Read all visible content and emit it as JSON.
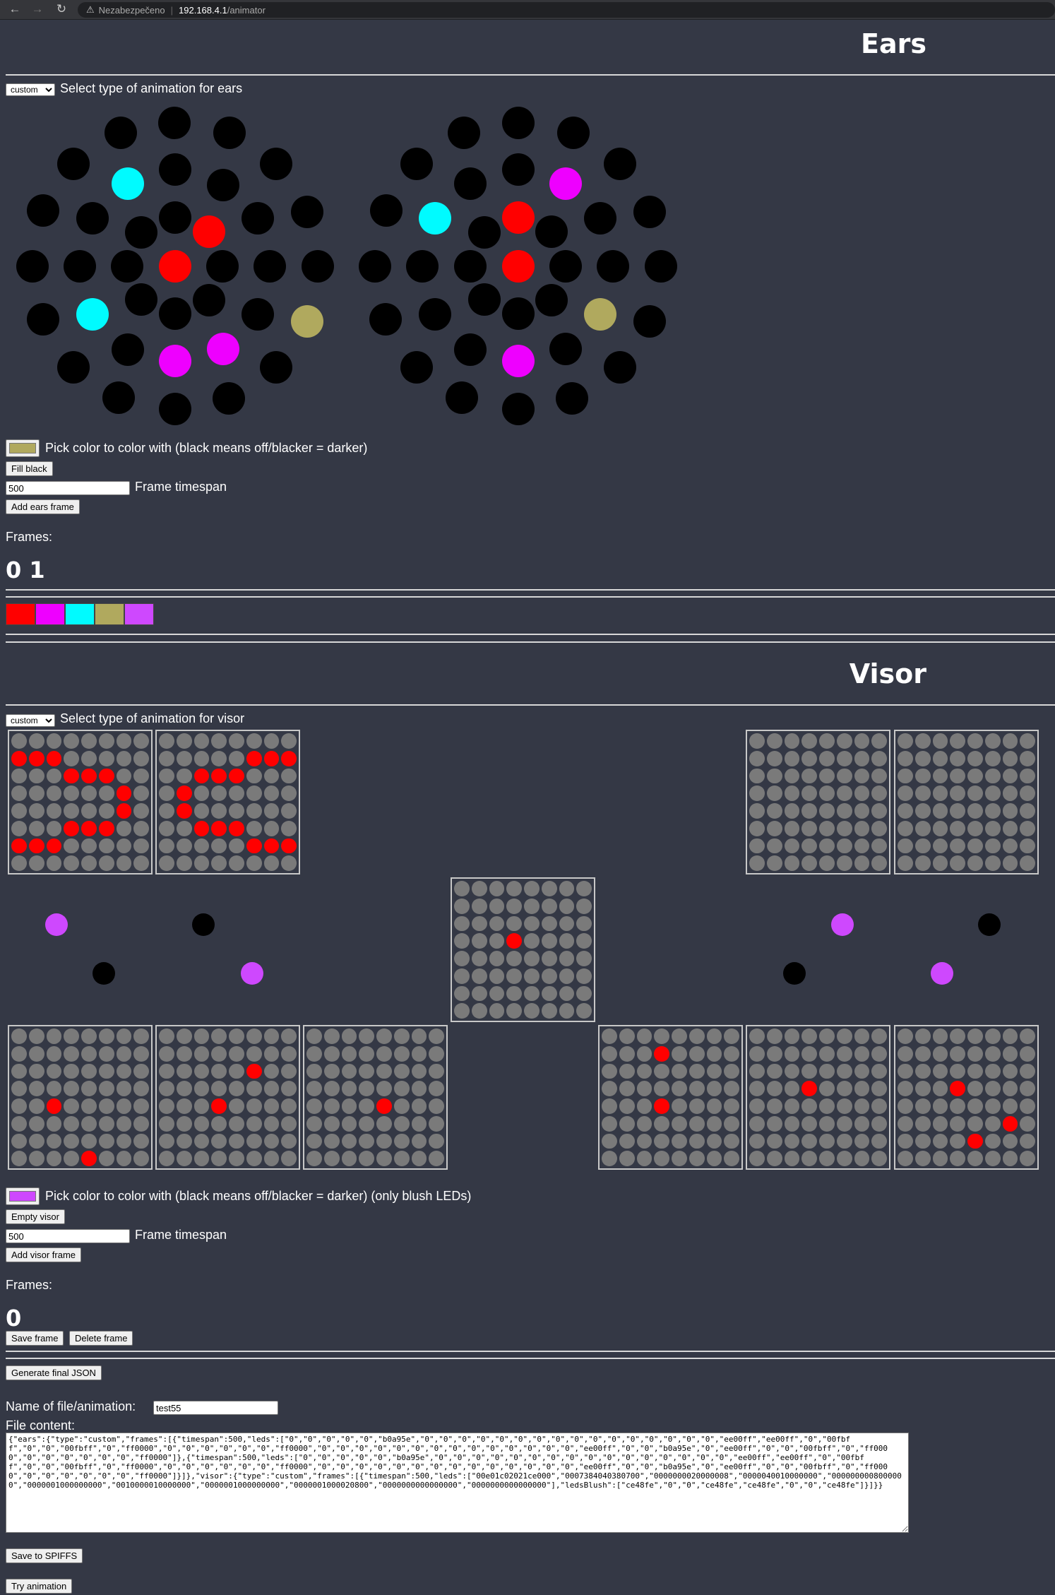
{
  "browser": {
    "security_label": "Nezabezpečeno",
    "url_host": "192.168.4.1",
    "url_path": "/animator"
  },
  "ears": {
    "title": "Ears",
    "select_value": "custom",
    "select_label": "Select type of animation for ears",
    "color_hex": "#b0a95e",
    "color_label": "Pick color to color with (black means off/blacker = darker)",
    "fill_black_label": "Fill black",
    "timespan_value": "500",
    "timespan_label": "Frame timespan",
    "add_frame_label": "Add ears frame",
    "frames_label": "Frames:",
    "frames": [
      "0",
      "1"
    ],
    "palette": [
      "#ff0000",
      "#ee00ff",
      "#00fbff",
      "#b0a95e",
      "#ce48fe"
    ]
  },
  "visor": {
    "title": "Visor",
    "select_value": "custom",
    "select_label": "Select type of animation for visor",
    "color_hex": "#ce48fe",
    "color_label": "Pick color to color with (black means off/blacker = darker) (only blush LEDs)",
    "empty_label": "Empty visor",
    "timespan_value": "500",
    "timespan_label": "Frame timespan",
    "add_frame_label": "Add visor frame",
    "frames_label": "Frames:",
    "frames": [
      "0"
    ],
    "save_frame_label": "Save frame",
    "delete_frame_label": "Delete frame"
  },
  "final": {
    "generate_label": "Generate final JSON",
    "name_label": "Name of file/animation:",
    "name_value": "test55",
    "file_content_label": "File content:",
    "file_content": "{\"ears\":{\"type\":\"custom\",\"frames\":[{\"timespan\":500,\"leds\":[\"0\",\"0\",\"0\",\"0\",\"0\",\"b0a95e\",\"0\",\"0\",\"0\",\"0\",\"0\",\"0\",\"0\",\"0\",\"0\",\"0\",\"0\",\"0\",\"0\",\"0\",\"0\",\"0\",\"ee00ff\",\"ee00ff\",\"0\",\"00fbff\",\"0\",\"0\",\"00fbff\",\"0\",\"ff0000\",\"0\",\"0\",\"0\",\"0\",\"0\",\"0\",\"ff0000\",\"0\",\"0\",\"0\",\"0\",\"0\",\"0\",\"0\",\"0\",\"0\",\"0\",\"0\",\"0\",\"0\",\"0\",\"ee00ff\",\"0\",\"0\",\"b0a95e\",\"0\",\"ee00ff\",\"0\",\"0\",\"00fbff\",\"0\",\"ff0000\",\"0\",\"0\",\"0\",\"0\",\"0\",\"0\",\"ff0000\"]},{\"timespan\":500,\"leds\":[\"0\",\"0\",\"0\",\"0\",\"0\",\"b0a95e\",\"0\",\"0\",\"0\",\"0\",\"0\",\"0\",\"0\",\"0\",\"0\",\"0\",\"0\",\"0\",\"0\",\"0\",\"0\",\"0\",\"ee00ff\",\"ee00ff\",\"0\",\"00fbff\",\"0\",\"0\",\"00fbff\",\"0\",\"ff0000\",\"0\",\"0\",\"0\",\"0\",\"0\",\"0\",\"ff0000\",\"0\",\"0\",\"0\",\"0\",\"0\",\"0\",\"0\",\"0\",\"0\",\"0\",\"0\",\"0\",\"0\",\"0\",\"ee00ff\",\"0\",\"0\",\"b0a95e\",\"0\",\"ee00ff\",\"0\",\"0\",\"00fbff\",\"0\",\"ff0000\",\"0\",\"0\",\"0\",\"0\",\"0\",\"0\",\"ff0000\"]}]},\"visor\":{\"type\":\"custom\",\"frames\":[{\"timespan\":500,\"leds\":[\"00e01c02021ce000\",\"0007384040380700\",\"0000000020000008\",\"0000040010000000\",\"0000000008000000\",\"0000001000000000\",\"0010000010000000\",\"0000001000000000\",\"0000001000020800\",\"0000000000000000\",\"0000000000000000\"],\"ledsBlush\":[\"ce48fe\",\"0\",\"0\",\"ce48fe\",\"ce48fe\",\"0\",\"0\",\"ce48fe\"]}]}}",
    "save_label": "Save to SPIFFS",
    "try_label": "Try animation"
  }
}
